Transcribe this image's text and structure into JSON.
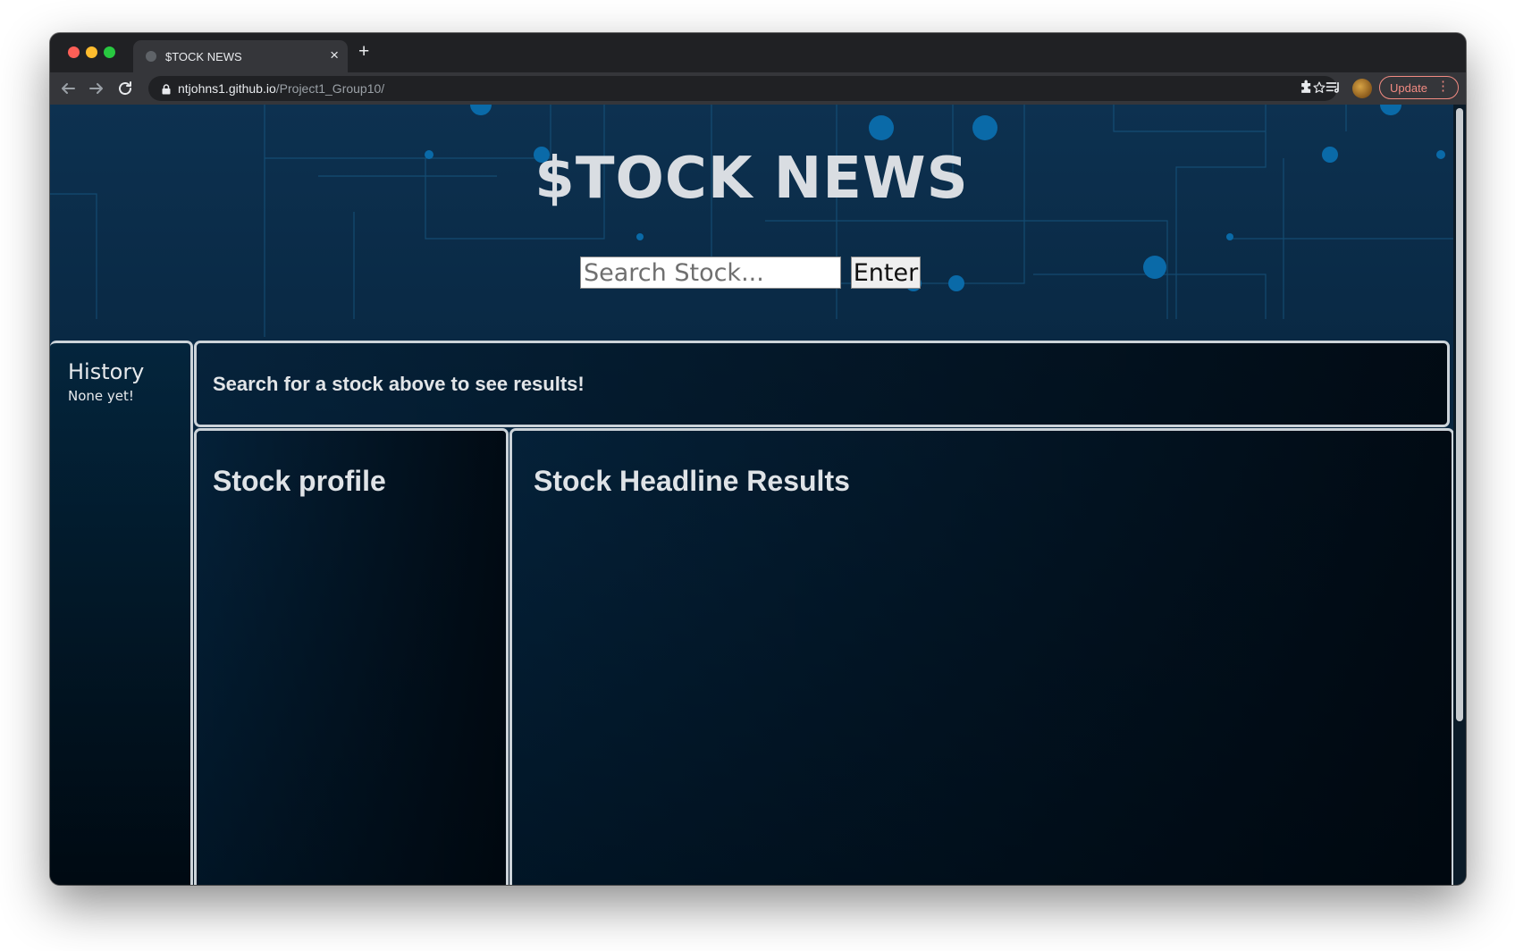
{
  "browser": {
    "tab": {
      "title": "$TOCK NEWS",
      "close_glyph": "×"
    },
    "new_tab_glyph": "+",
    "address": {
      "host": "ntjohns1.github.io",
      "path": "/Project1_Group10/"
    },
    "update_label": "Update",
    "menu_glyph": "⋮",
    "icons": [
      "back-arrow-icon",
      "forward-arrow-icon",
      "reload-icon",
      "lock-icon",
      "star-icon",
      "extensions-puzzle-icon",
      "media-queue-icon",
      "profile-avatar",
      "kebab-menu-icon"
    ]
  },
  "page": {
    "title": "$TOCK NEWS",
    "search": {
      "placeholder": "Search Stock...",
      "value": "",
      "button_label": "Enter"
    },
    "history": {
      "title": "History",
      "empty_text": "None yet!"
    },
    "prompt": "Search for a stock above to see results!",
    "profile_heading": "Stock profile",
    "results_heading": "Stock Headline Results"
  },
  "colors": {
    "page_bg_top": "#0d3150",
    "page_bg_bottom": "#021322",
    "circuit_node": "#0a6aa8",
    "panel_border": "#ccd3d9",
    "update_accent": "#f28b82"
  }
}
